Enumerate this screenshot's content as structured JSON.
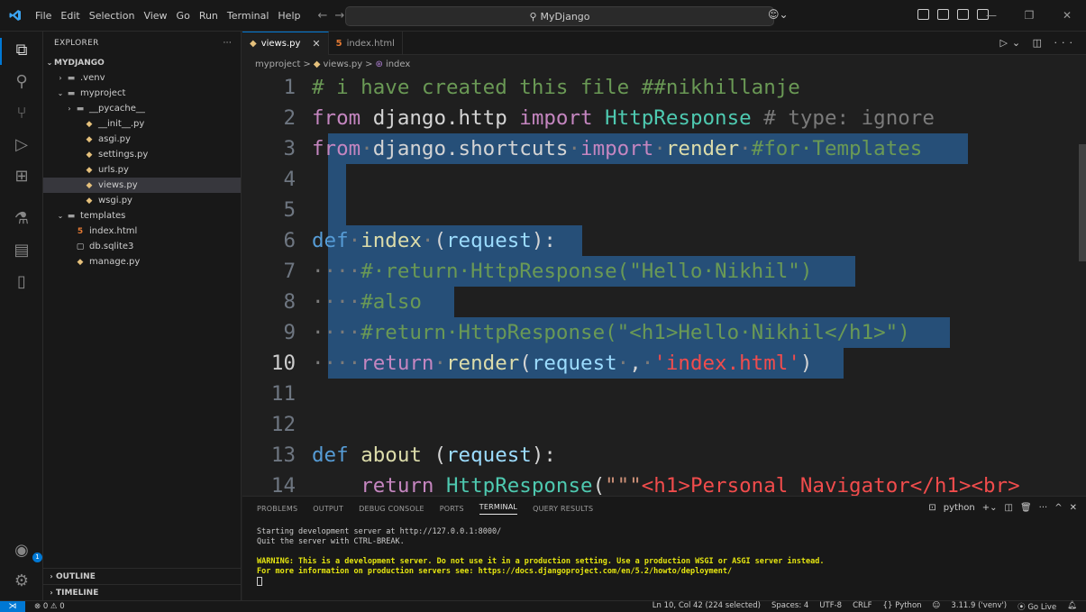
{
  "titlebar": {
    "menu": [
      "File",
      "Edit",
      "Selection",
      "View",
      "Go",
      "Run",
      "Terminal",
      "Help"
    ],
    "search": "MyDjango"
  },
  "sidebar": {
    "title": "EXPLORER",
    "more": "···",
    "root": "MYDJANGO",
    "items": [
      {
        "label": ".venv",
        "indent": 1,
        "type": "folder",
        "open": false
      },
      {
        "label": "myproject",
        "indent": 1,
        "type": "folder",
        "open": true
      },
      {
        "label": "__pycache__",
        "indent": 2,
        "type": "folder",
        "open": false
      },
      {
        "label": "__init__.py",
        "indent": 3,
        "type": "py"
      },
      {
        "label": "asgi.py",
        "indent": 3,
        "type": "py"
      },
      {
        "label": "settings.py",
        "indent": 3,
        "type": "py"
      },
      {
        "label": "urls.py",
        "indent": 3,
        "type": "py"
      },
      {
        "label": "views.py",
        "indent": 3,
        "type": "py",
        "selected": true
      },
      {
        "label": "wsgi.py",
        "indent": 3,
        "type": "py"
      },
      {
        "label": "templates",
        "indent": 1,
        "type": "folder",
        "open": true
      },
      {
        "label": "index.html",
        "indent": 2,
        "type": "html"
      },
      {
        "label": "db.sqlite3",
        "indent": 2,
        "type": "db"
      },
      {
        "label": "manage.py",
        "indent": 2,
        "type": "py"
      }
    ],
    "outline": "OUTLINE",
    "timeline": "TIMELINE"
  },
  "tabs": [
    {
      "label": "views.py",
      "active": true,
      "close": "✕"
    },
    {
      "label": "index.html",
      "active": false
    }
  ],
  "breadcrumbs": [
    "myproject",
    ">",
    "views.py",
    ">",
    "index"
  ],
  "editor": {
    "lines": [
      "1",
      "2",
      "3",
      "4",
      "5",
      "6",
      "7",
      "8",
      "9",
      "10",
      "11",
      "12",
      "13",
      "14"
    ],
    "current_line": "10"
  },
  "panel": {
    "tabs": [
      "PROBLEMS",
      "OUTPUT",
      "DEBUG CONSOLE",
      "PORTS",
      "TERMINAL",
      "QUERY RESULTS"
    ],
    "active_tab": "TERMINAL",
    "shell": "python",
    "terminal": {
      "line1": "Starting development server at http://127.0.0.1:8000/",
      "line2": "Quit the server with CTRL-BREAK.",
      "warn1": "WARNING: This is a development server. Do not use it in a production setting. Use a production WSGI or ASGI server instead.",
      "warn2": "For more information on production servers see: https://docs.djangoproject.com/en/5.2/howto/deployment/"
    }
  },
  "statusbar": {
    "problems": "⊗ 0 ⚠ 0",
    "position": "Ln 10, Col 42 (224 selected)",
    "spaces": "Spaces: 4",
    "encoding": "UTF-8",
    "eol": "CRLF",
    "language": "{} Python",
    "interpreter": "3.11.9 ('venv')",
    "golive": "⦿ Go Live"
  }
}
